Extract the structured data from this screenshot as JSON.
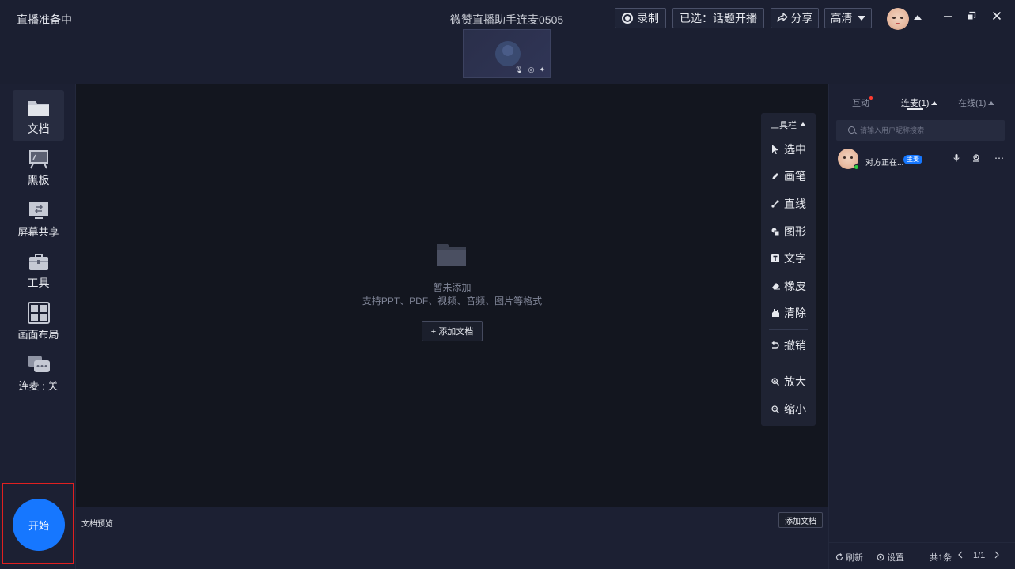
{
  "titlebar": {
    "status": "直播准备中",
    "title": "微赞直播助手连麦0505",
    "record_label": "录制",
    "selected_label": "已选：话题开播",
    "share_label": "分享",
    "quality_label": "高清"
  },
  "sidebar": {
    "items": [
      {
        "label": "文档",
        "icon": "folder-icon"
      },
      {
        "label": "黑板",
        "icon": "blackboard-icon"
      },
      {
        "label": "屏幕共享",
        "icon": "screen-share-icon"
      },
      {
        "label": "工具",
        "icon": "toolbox-icon"
      },
      {
        "label": "画面布局",
        "icon": "layout-icon"
      },
      {
        "label": "连麦 : 关",
        "icon": "chat-bubble-icon"
      }
    ],
    "start_label": "开始"
  },
  "canvas": {
    "empty_title": "暂未添加",
    "empty_sub": "支持PPT、PDF、视频、音频、图片等格式",
    "add_doc_label": "+ 添加文档"
  },
  "toolbar": {
    "header": "工具栏",
    "tools": [
      {
        "label": "选中",
        "icon": "cursor-icon"
      },
      {
        "label": "画笔",
        "icon": "pen-icon"
      },
      {
        "label": "直线",
        "icon": "line-icon"
      },
      {
        "label": "图形",
        "icon": "shape-icon"
      },
      {
        "label": "文字",
        "icon": "text-icon"
      },
      {
        "label": "橡皮",
        "icon": "eraser-icon"
      },
      {
        "label": "清除",
        "icon": "clear-icon"
      },
      {
        "label": "撤销",
        "icon": "undo-icon"
      },
      {
        "label": "放大",
        "icon": "zoom-in-icon"
      },
      {
        "label": "缩小",
        "icon": "zoom-out-icon"
      }
    ]
  },
  "doc_strip": {
    "label": "文档预览",
    "add_label": "添加文档"
  },
  "right_panel": {
    "tabs": [
      {
        "label": "互动"
      },
      {
        "label": "连麦(1)"
      },
      {
        "label": "在线(1)"
      }
    ],
    "search_placeholder": "请输入用户昵称搜索",
    "user": {
      "name": "对方正在...",
      "badge": "主麦"
    },
    "footer": {
      "refresh": "刷新",
      "settings": "设置",
      "total": "共1条",
      "page": "1/1"
    }
  },
  "colors": {
    "accent": "#1677ff",
    "background": "#1c2033",
    "canvas": "#13161f",
    "highlight_border": "#e02020"
  }
}
